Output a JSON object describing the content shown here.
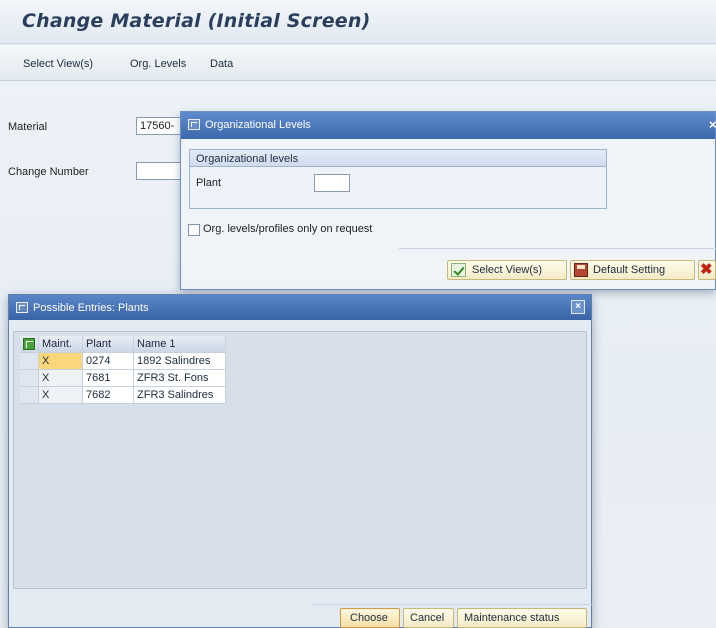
{
  "window": {
    "title": "Change Material (Initial Screen)"
  },
  "menu": {
    "items": [
      "Select View(s)",
      "Org. Levels",
      "Data"
    ]
  },
  "fields": {
    "material_label": "Material",
    "material_value": "17560-",
    "change_number_label": "Change Number",
    "change_number_value": ""
  },
  "org_dialog": {
    "title": "Organizational Levels",
    "close": "×",
    "group_title": "Organizational levels",
    "plant_label": "Plant",
    "plant_value": "",
    "checkbox_label": "Org. levels/profiles only on request",
    "buttons": {
      "select_views": "Select View(s)",
      "default_setting": "Default Setting"
    }
  },
  "entries_dialog": {
    "title": "Possible Entries: Plants",
    "close": "×",
    "columns": [
      "Maint.",
      "Plant",
      "Name 1"
    ],
    "rows": [
      {
        "maint": "X",
        "plant": "0274",
        "name": "1892 Salindres"
      },
      {
        "maint": "X",
        "plant": "7681",
        "name": "ZFR3 St. Fons"
      },
      {
        "maint": "X",
        "plant": "7682",
        "name": "ZFR3 Salindres"
      }
    ],
    "buttons": {
      "choose": "Choose",
      "cancel": "Cancel",
      "maintenance_status": "Maintenance status"
    }
  },
  "colors": {
    "dialog_title_bar": "#4a77bb",
    "button_face": "#f6edc8",
    "focus_cell": "#fbd77c",
    "check_icon": "#2f8a1f",
    "cancel_icon": "#c22312"
  },
  "icons": {
    "dialog": "window-icon",
    "select_views": "green-check-icon",
    "default_setting": "save-icon",
    "cancel": "red-x-icon",
    "grid_settings": "grid-settings-icon"
  }
}
